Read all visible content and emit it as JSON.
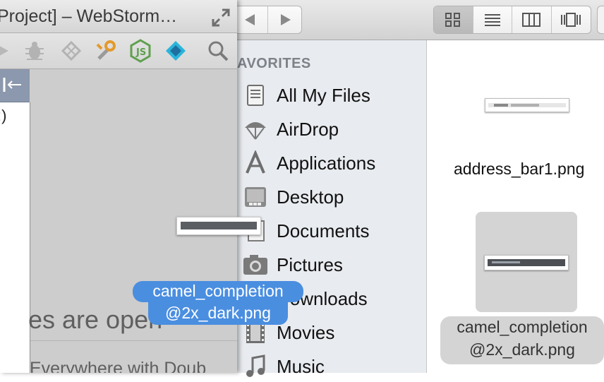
{
  "webstorm": {
    "title": "Project] – WebStorm…",
    "project_tree_fragment": ":)",
    "editor_hint_big": "es are open",
    "editor_hint_small": "Everywhere with Doub",
    "toolbar_icons": [
      "run-icon",
      "debug-icon",
      "coverage-icon",
      "wrench-icon",
      "nodejs-icon",
      "diamond-icon",
      "search-icon"
    ]
  },
  "finder": {
    "sidebar_heading": "AVORITES",
    "sidebar_items": [
      {
        "label": "All My Files",
        "icon": "all-files-icon"
      },
      {
        "label": "AirDrop",
        "icon": "airdrop-icon"
      },
      {
        "label": "Applications",
        "icon": "applications-icon"
      },
      {
        "label": "Desktop",
        "icon": "desktop-icon"
      },
      {
        "label": "Documents",
        "icon": "documents-icon"
      },
      {
        "label": "Pictures",
        "icon": "pictures-icon"
      },
      {
        "label": "Downloads",
        "icon": "downloads-icon"
      },
      {
        "label": "Movies",
        "icon": "movies-icon"
      },
      {
        "label": "Music",
        "icon": "music-icon"
      }
    ],
    "files": [
      {
        "name": "address_bar1.png"
      },
      {
        "name_line1": "camel_completion",
        "name_line2": "@2x_dark.png",
        "selected": true
      }
    ],
    "view_modes": [
      "icon-view",
      "list-view",
      "column-view",
      "coverflow-view"
    ]
  },
  "drag": {
    "label_line1": "camel_completion",
    "label_line2": "@2x_dark.png"
  },
  "colors": {
    "selection_blue": "#4a8ee0",
    "sidebar_bg": "#e8ebef",
    "project_header": "#8b98ad"
  }
}
